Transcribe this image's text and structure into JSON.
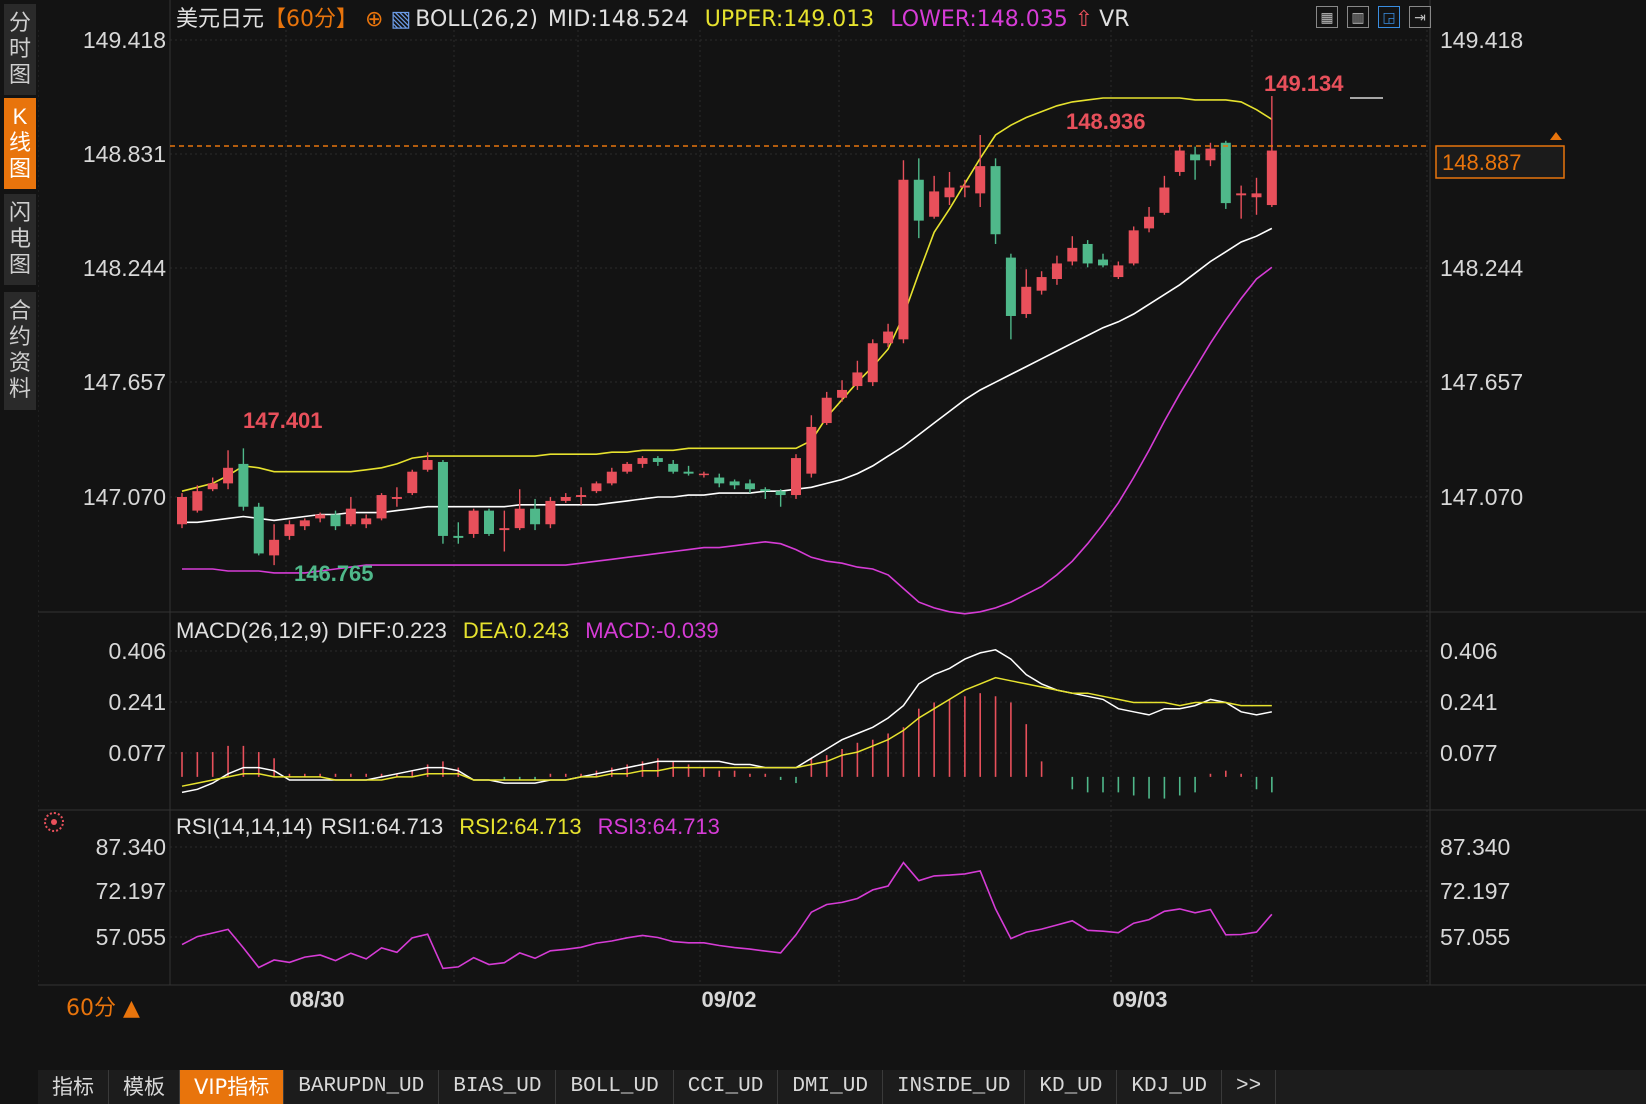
{
  "symbol_title": "美元日元",
  "period_tag": "【60分】",
  "boll_legend": {
    "name": "BOLL(26,2)",
    "mid": "MID:148.524",
    "upper": "UPPER:149.013",
    "lower": "LOWER:148.035",
    "vr": "VR"
  },
  "macd_legend": {
    "name": "MACD(26,12,9)",
    "diff": "DIFF:0.223",
    "dea": "DEA:0.243",
    "macd": "MACD:-0.039"
  },
  "rsi_legend": {
    "name": "RSI(14,14,14)",
    "rsi1": "RSI1:64.713",
    "rsi2": "RSI2:64.713",
    "rsi3": "RSI3:64.713"
  },
  "nav": [
    {
      "label": "分时图",
      "chars": [
        "分",
        "时",
        "图"
      ],
      "active": false
    },
    {
      "label": "K线图",
      "chars": [
        "K",
        "线",
        "图"
      ],
      "active": true
    },
    {
      "label": "闪电图",
      "chars": [
        "闪",
        "电",
        "图"
      ],
      "active": false
    },
    {
      "label": "合约资料",
      "chars": [
        "合",
        "约",
        "资",
        "料"
      ],
      "active": false
    }
  ],
  "period_selector": "60分 ▲",
  "price_axis": [
    "149.418",
    "148.831",
    "148.244",
    "147.657",
    "147.070"
  ],
  "macd_axis": [
    "0.406",
    "0.241",
    "0.077"
  ],
  "rsi_axis": [
    "87.340",
    "72.197",
    "57.055"
  ],
  "date_labels": [
    "08/30",
    "09/02",
    "09/03"
  ],
  "current_price": "148.887",
  "annotations": {
    "high_left": "147.401",
    "low_left": "146.765",
    "high_mid": "148.936",
    "high_right": "149.134"
  },
  "toolbar_icons": [
    "grid-icon",
    "chart-split-icon",
    "chart-active-icon",
    "exit-icon"
  ],
  "bottom_tabs": [
    "指标",
    "模板",
    "VIP指标",
    "BARUPDN_UD",
    "BIAS_UD",
    "BOLL_UD",
    "CCI_UD",
    "DMI_UD",
    "INSIDE_UD",
    "KD_UD",
    "KDJ_UD",
    ">>"
  ],
  "colors": {
    "up": "#e8505b",
    "down": "#4fb88a",
    "boll_upper": "#e6e22e",
    "boll_mid": "#ffffff",
    "boll_lower": "#d63cd6",
    "accent": "#e8740c",
    "label_red": "#e8505b",
    "label_green": "#4fb88a"
  },
  "chart_data": {
    "type": "candlestick",
    "period": "60分",
    "price_ticks": [
      149.418,
      148.831,
      148.244,
      147.657,
      147.07
    ],
    "candles": [
      {
        "o": 146.93,
        "c": 147.07,
        "h": 147.09,
        "l": 146.91
      },
      {
        "o": 147.0,
        "c": 147.1,
        "h": 147.13,
        "l": 146.99
      },
      {
        "o": 147.11,
        "c": 147.14,
        "h": 147.17,
        "l": 147.1
      },
      {
        "o": 147.14,
        "c": 147.22,
        "h": 147.31,
        "l": 147.11
      },
      {
        "o": 147.24,
        "c": 147.02,
        "h": 147.32,
        "l": 147.0
      },
      {
        "o": 147.02,
        "c": 146.78,
        "h": 147.04,
        "l": 146.77
      },
      {
        "o": 146.77,
        "c": 146.85,
        "h": 146.93,
        "l": 146.72
      },
      {
        "o": 146.87,
        "c": 146.93,
        "h": 146.95,
        "l": 146.85
      },
      {
        "o": 146.92,
        "c": 146.95,
        "h": 146.96,
        "l": 146.9
      },
      {
        "o": 146.96,
        "c": 146.98,
        "h": 146.99,
        "l": 146.94
      },
      {
        "o": 146.98,
        "c": 146.92,
        "h": 147.0,
        "l": 146.9
      },
      {
        "o": 146.93,
        "c": 147.01,
        "h": 147.07,
        "l": 146.92
      },
      {
        "o": 146.93,
        "c": 146.96,
        "h": 146.98,
        "l": 146.91
      },
      {
        "o": 146.96,
        "c": 147.08,
        "h": 147.09,
        "l": 146.95
      },
      {
        "o": 147.06,
        "c": 147.07,
        "h": 147.12,
        "l": 147.02
      },
      {
        "o": 147.09,
        "c": 147.2,
        "h": 147.21,
        "l": 147.08
      },
      {
        "o": 147.21,
        "c": 147.26,
        "h": 147.3,
        "l": 147.2
      },
      {
        "o": 147.25,
        "c": 146.87,
        "h": 147.26,
        "l": 146.83
      },
      {
        "o": 146.87,
        "c": 146.86,
        "h": 146.94,
        "l": 146.83
      },
      {
        "o": 146.88,
        "c": 147.0,
        "h": 147.01,
        "l": 146.86
      },
      {
        "o": 147.0,
        "c": 146.88,
        "h": 147.01,
        "l": 146.87
      },
      {
        "o": 146.9,
        "c": 146.91,
        "h": 147.0,
        "l": 146.79
      },
      {
        "o": 146.91,
        "c": 147.01,
        "h": 147.11,
        "l": 146.9
      },
      {
        "o": 147.01,
        "c": 146.93,
        "h": 147.06,
        "l": 146.9
      },
      {
        "o": 146.93,
        "c": 147.05,
        "h": 147.07,
        "l": 146.91
      },
      {
        "o": 147.05,
        "c": 147.07,
        "h": 147.09,
        "l": 147.04
      },
      {
        "o": 147.07,
        "c": 147.08,
        "h": 147.12,
        "l": 147.03
      },
      {
        "o": 147.1,
        "c": 147.14,
        "h": 147.15,
        "l": 147.09
      },
      {
        "o": 147.14,
        "c": 147.2,
        "h": 147.22,
        "l": 147.13
      },
      {
        "o": 147.2,
        "c": 147.24,
        "h": 147.25,
        "l": 147.19
      },
      {
        "o": 147.24,
        "c": 147.27,
        "h": 147.28,
        "l": 147.22
      },
      {
        "o": 147.27,
        "c": 147.25,
        "h": 147.28,
        "l": 147.23
      },
      {
        "o": 147.24,
        "c": 147.2,
        "h": 147.26,
        "l": 147.19
      },
      {
        "o": 147.2,
        "c": 147.19,
        "h": 147.23,
        "l": 147.18
      },
      {
        "o": 147.19,
        "c": 147.19,
        "h": 147.2,
        "l": 147.17
      },
      {
        "o": 147.17,
        "c": 147.14,
        "h": 147.19,
        "l": 147.12
      },
      {
        "o": 147.15,
        "c": 147.13,
        "h": 147.16,
        "l": 147.11
      },
      {
        "o": 147.14,
        "c": 147.11,
        "h": 147.16,
        "l": 147.09
      },
      {
        "o": 147.11,
        "c": 147.1,
        "h": 147.12,
        "l": 147.06
      },
      {
        "o": 147.1,
        "c": 147.08,
        "h": 147.11,
        "l": 147.02
      },
      {
        "o": 147.08,
        "c": 147.27,
        "h": 147.29,
        "l": 147.06
      },
      {
        "o": 147.19,
        "c": 147.43,
        "h": 147.49,
        "l": 147.17
      },
      {
        "o": 147.45,
        "c": 147.58,
        "h": 147.61,
        "l": 147.44
      },
      {
        "o": 147.58,
        "c": 147.62,
        "h": 147.67,
        "l": 147.56
      },
      {
        "o": 147.64,
        "c": 147.71,
        "h": 147.77,
        "l": 147.62
      },
      {
        "o": 147.66,
        "c": 147.86,
        "h": 147.88,
        "l": 147.64
      },
      {
        "o": 147.86,
        "c": 147.92,
        "h": 147.96,
        "l": 147.84
      },
      {
        "o": 147.88,
        "c": 148.7,
        "h": 148.8,
        "l": 147.86
      },
      {
        "o": 148.7,
        "c": 148.49,
        "h": 148.81,
        "l": 148.4
      },
      {
        "o": 148.51,
        "c": 148.64,
        "h": 148.72,
        "l": 148.5
      },
      {
        "o": 148.61,
        "c": 148.66,
        "h": 148.74,
        "l": 148.57
      },
      {
        "o": 148.66,
        "c": 148.67,
        "h": 148.7,
        "l": 148.61
      },
      {
        "o": 148.63,
        "c": 148.77,
        "h": 148.93,
        "l": 148.56
      },
      {
        "o": 148.77,
        "c": 148.42,
        "h": 148.81,
        "l": 148.37
      },
      {
        "o": 148.3,
        "c": 148.0,
        "h": 148.32,
        "l": 147.88
      },
      {
        "o": 148.01,
        "c": 148.15,
        "h": 148.24,
        "l": 147.99
      },
      {
        "o": 148.13,
        "c": 148.2,
        "h": 148.23,
        "l": 148.11
      },
      {
        "o": 148.19,
        "c": 148.27,
        "h": 148.31,
        "l": 148.16
      },
      {
        "o": 148.28,
        "c": 148.35,
        "h": 148.41,
        "l": 148.26
      },
      {
        "o": 148.37,
        "c": 148.27,
        "h": 148.39,
        "l": 148.25
      },
      {
        "o": 148.29,
        "c": 148.26,
        "h": 148.32,
        "l": 148.25
      },
      {
        "o": 148.2,
        "c": 148.26,
        "h": 148.28,
        "l": 148.19
      },
      {
        "o": 148.27,
        "c": 148.44,
        "h": 148.46,
        "l": 148.26
      },
      {
        "o": 148.45,
        "c": 148.51,
        "h": 148.56,
        "l": 148.43
      },
      {
        "o": 148.53,
        "c": 148.66,
        "h": 148.72,
        "l": 148.52
      },
      {
        "o": 148.74,
        "c": 148.85,
        "h": 148.88,
        "l": 148.72
      },
      {
        "o": 148.83,
        "c": 148.8,
        "h": 148.87,
        "l": 148.7
      },
      {
        "o": 148.8,
        "c": 148.86,
        "h": 148.89,
        "l": 148.77
      },
      {
        "o": 148.89,
        "c": 148.58,
        "h": 148.9,
        "l": 148.55
      },
      {
        "o": 148.62,
        "c": 148.63,
        "h": 148.67,
        "l": 148.5
      },
      {
        "o": 148.61,
        "c": 148.63,
        "h": 148.71,
        "l": 148.52
      },
      {
        "o": 148.57,
        "c": 148.85,
        "h": 149.13,
        "l": 148.56
      }
    ],
    "boll_upper": [
      147.1,
      147.12,
      147.14,
      147.18,
      147.23,
      147.22,
      147.2,
      147.2,
      147.2,
      147.2,
      147.2,
      147.2,
      147.21,
      147.22,
      147.24,
      147.27,
      147.28,
      147.28,
      147.28,
      147.28,
      147.28,
      147.28,
      147.28,
      147.28,
      147.29,
      147.29,
      147.29,
      147.29,
      147.3,
      147.3,
      147.31,
      147.31,
      147.31,
      147.32,
      147.32,
      147.32,
      147.32,
      147.32,
      147.32,
      147.32,
      147.32,
      147.36,
      147.48,
      147.57,
      147.66,
      147.74,
      147.83,
      148.0,
      148.22,
      148.43,
      148.55,
      148.68,
      148.81,
      148.93,
      148.98,
      149.02,
      149.05,
      149.08,
      149.1,
      149.11,
      149.12,
      149.12,
      149.12,
      149.12,
      149.12,
      149.12,
      149.11,
      149.11,
      149.11,
      149.1,
      149.06,
      149.01
    ],
    "boll_mid": [
      146.94,
      146.94,
      146.95,
      146.96,
      146.97,
      146.96,
      146.95,
      146.96,
      146.97,
      146.98,
      146.98,
      146.99,
      146.99,
      146.99,
      147.0,
      147.01,
      147.02,
      147.02,
      147.02,
      147.02,
      147.02,
      147.02,
      147.03,
      147.03,
      147.03,
      147.03,
      147.03,
      147.03,
      147.04,
      147.05,
      147.06,
      147.07,
      147.07,
      147.08,
      147.08,
      147.09,
      147.09,
      147.09,
      147.1,
      147.1,
      147.11,
      147.12,
      147.14,
      147.16,
      147.19,
      147.23,
      147.28,
      147.33,
      147.39,
      147.45,
      147.51,
      147.57,
      147.62,
      147.66,
      147.7,
      147.74,
      147.78,
      147.82,
      147.86,
      147.9,
      147.94,
      147.97,
      148.01,
      148.06,
      148.11,
      148.16,
      148.22,
      148.28,
      148.33,
      148.38,
      148.41,
      148.45
    ],
    "boll_lower": [
      146.7,
      146.7,
      146.7,
      146.69,
      146.69,
      146.69,
      146.68,
      146.68,
      146.68,
      146.69,
      146.7,
      146.71,
      146.72,
      146.72,
      146.72,
      146.72,
      146.72,
      146.72,
      146.72,
      146.72,
      146.72,
      146.72,
      146.72,
      146.72,
      146.72,
      146.72,
      146.73,
      146.74,
      146.75,
      146.76,
      146.77,
      146.78,
      146.79,
      146.8,
      146.81,
      146.81,
      146.82,
      146.83,
      146.84,
      146.83,
      146.8,
      146.76,
      146.74,
      146.73,
      146.71,
      146.7,
      146.67,
      146.6,
      146.53,
      146.5,
      146.48,
      146.47,
      146.48,
      146.5,
      146.53,
      146.57,
      146.61,
      146.67,
      146.74,
      146.83,
      146.93,
      147.04,
      147.17,
      147.31,
      147.46,
      147.6,
      147.73,
      147.86,
      147.98,
      148.09,
      148.19,
      148.25
    ],
    "macd": {
      "diff": [
        -0.05,
        -0.04,
        -0.02,
        0.01,
        0.03,
        0.03,
        0.02,
        -0.01,
        -0.01,
        -0.01,
        -0.01,
        -0.01,
        -0.01,
        0.0,
        0.01,
        0.02,
        0.03,
        0.03,
        0.02,
        -0.01,
        -0.01,
        -0.02,
        -0.02,
        -0.02,
        -0.01,
        -0.01,
        0.0,
        0.01,
        0.02,
        0.03,
        0.04,
        0.05,
        0.05,
        0.05,
        0.05,
        0.05,
        0.04,
        0.04,
        0.03,
        0.03,
        0.03,
        0.06,
        0.09,
        0.12,
        0.14,
        0.16,
        0.19,
        0.23,
        0.3,
        0.33,
        0.35,
        0.38,
        0.4,
        0.41,
        0.38,
        0.33,
        0.3,
        0.28,
        0.27,
        0.26,
        0.25,
        0.22,
        0.21,
        0.2,
        0.22,
        0.22,
        0.23,
        0.25,
        0.24,
        0.21,
        0.2,
        0.21
      ],
      "dea": [
        -0.03,
        -0.02,
        -0.01,
        0.0,
        0.01,
        0.01,
        0.0,
        0.0,
        0.0,
        0.0,
        -0.01,
        -0.01,
        -0.01,
        -0.01,
        0.0,
        0.0,
        0.01,
        0.01,
        0.01,
        -0.01,
        -0.01,
        -0.01,
        -0.01,
        -0.01,
        -0.01,
        -0.01,
        0.0,
        0.0,
        0.01,
        0.01,
        0.02,
        0.02,
        0.03,
        0.03,
        0.03,
        0.03,
        0.03,
        0.03,
        0.03,
        0.03,
        0.03,
        0.04,
        0.05,
        0.07,
        0.08,
        0.1,
        0.12,
        0.15,
        0.19,
        0.22,
        0.25,
        0.28,
        0.3,
        0.32,
        0.31,
        0.3,
        0.29,
        0.28,
        0.27,
        0.27,
        0.26,
        0.25,
        0.24,
        0.24,
        0.24,
        0.23,
        0.24,
        0.24,
        0.24,
        0.23,
        0.23,
        0.23
      ],
      "hist": [
        0.08,
        0.08,
        0.08,
        0.1,
        0.1,
        0.08,
        0.06,
        0.01,
        0.01,
        0.01,
        0.01,
        0.01,
        0.01,
        0.01,
        0.01,
        0.02,
        0.04,
        0.05,
        0.03,
        0.0,
        0.0,
        -0.01,
        -0.01,
        -0.01,
        0.01,
        0.01,
        0.01,
        0.02,
        0.03,
        0.04,
        0.05,
        0.06,
        0.05,
        0.04,
        0.03,
        0.02,
        0.02,
        0.01,
        0.01,
        -0.01,
        -0.02,
        0.06,
        0.07,
        0.09,
        0.11,
        0.12,
        0.14,
        0.16,
        0.22,
        0.24,
        0.25,
        0.26,
        0.27,
        0.26,
        0.24,
        0.17,
        0.05,
        0.0,
        -0.04,
        -0.05,
        -0.05,
        -0.05,
        -0.06,
        -0.07,
        -0.07,
        -0.06,
        -0.05,
        0.01,
        0.02,
        0.01,
        -0.04,
        -0.05,
        -0.06,
        -0.04
      ],
      "ticks": [
        0.406,
        0.241,
        0.077
      ]
    },
    "rsi": {
      "values": [
        54.5,
        57.2,
        58.4,
        59.6,
        53.4,
        46.8,
        49.3,
        48.5,
        50.3,
        51.0,
        49.1,
        51.6,
        49.7,
        53.4,
        51.9,
        56.8,
        58.0,
        46.5,
        47.0,
        50.1,
        47.8,
        48.4,
        51.7,
        49.9,
        52.4,
        52.9,
        53.6,
        55.0,
        55.7,
        56.8,
        57.6,
        56.9,
        55.5,
        55.1,
        55.1,
        54.2,
        53.5,
        53.0,
        52.3,
        51.7,
        57.8,
        65.4,
        68.0,
        68.7,
        70.0,
        72.9,
        74.2,
        82.1,
        76.0,
        77.6,
        77.9,
        78.3,
        79.3,
        66.5,
        56.5,
        58.7,
        59.7,
        61.1,
        62.5,
        59.3,
        59.0,
        58.5,
        61.7,
        62.9,
        65.7,
        66.5,
        65.2,
        66.3,
        57.8,
        57.9,
        58.7,
        64.7
      ],
      "ticks": [
        87.34,
        72.197,
        57.055
      ]
    }
  }
}
